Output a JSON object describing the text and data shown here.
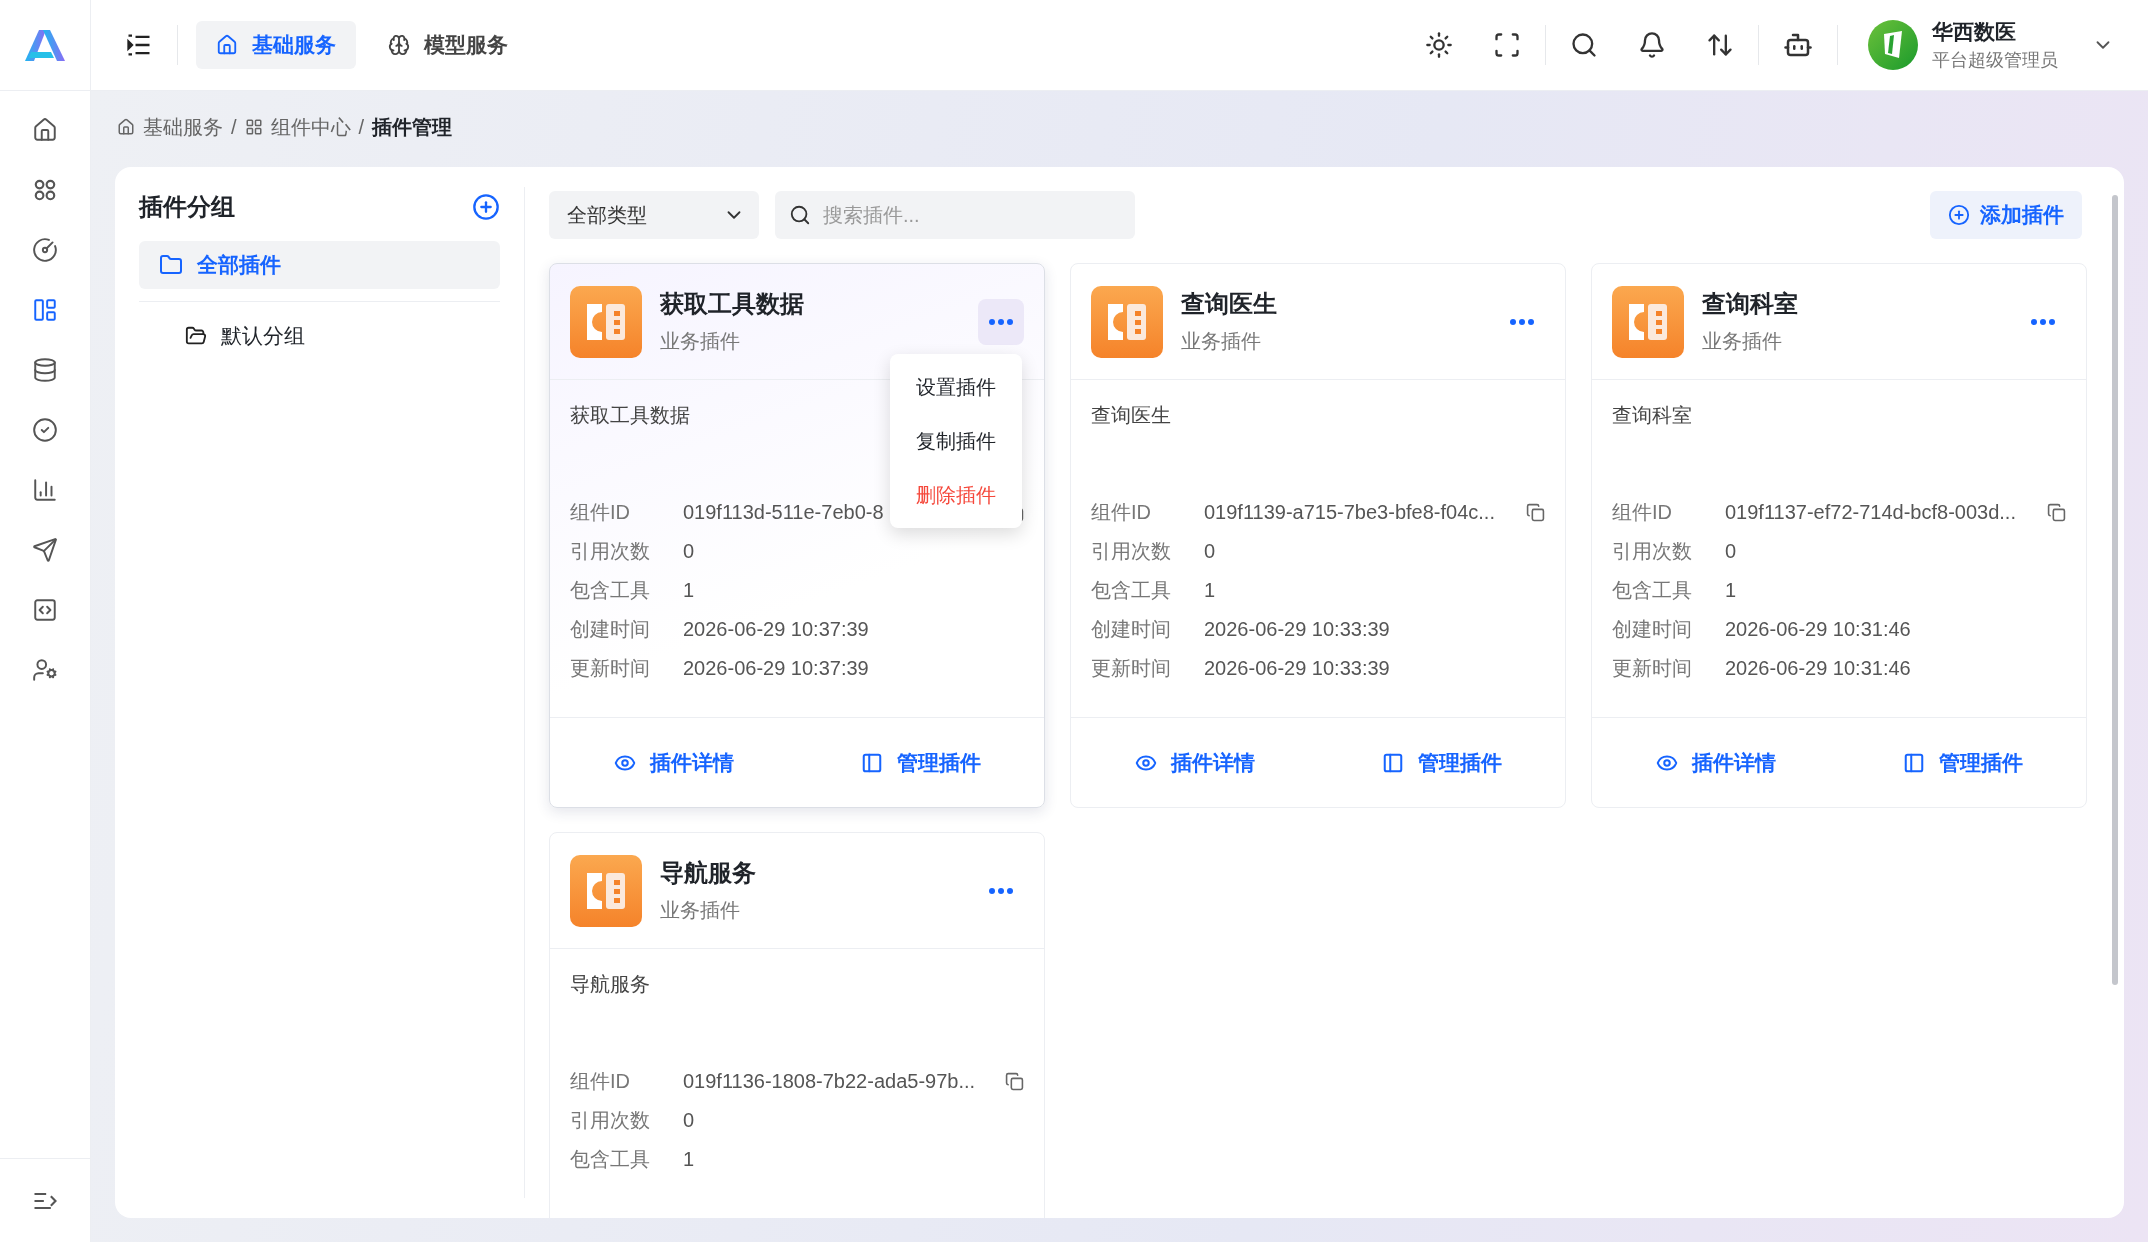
{
  "header": {
    "nav_tabs": [
      {
        "label": "基础服务",
        "kind": "home",
        "selected": true
      },
      {
        "label": "模型服务",
        "kind": "brain",
        "selected": false
      }
    ],
    "user": {
      "name": "华西数医",
      "role": "平台超级管理员"
    }
  },
  "sidebar": {
    "items": [
      {
        "kind": "home",
        "selected": false
      },
      {
        "kind": "apps",
        "selected": false
      },
      {
        "kind": "gauge",
        "selected": false
      },
      {
        "kind": "layout",
        "selected": true
      },
      {
        "kind": "database",
        "selected": false
      },
      {
        "kind": "check",
        "selected": false
      },
      {
        "kind": "chart",
        "selected": false
      },
      {
        "kind": "send",
        "selected": false
      },
      {
        "kind": "code",
        "selected": false
      },
      {
        "kind": "user-settings",
        "selected": false
      }
    ]
  },
  "breadcrumb": {
    "separator": "/",
    "items": [
      {
        "label": "基础服务",
        "kind": "home"
      },
      {
        "label": "组件中心",
        "kind": "grid"
      },
      {
        "label": "插件管理",
        "kind": "current"
      }
    ]
  },
  "groups": {
    "title": "插件分组",
    "items": [
      {
        "label": "全部插件",
        "selected": true,
        "children": [
          {
            "label": "默认分组",
            "selected": false
          }
        ]
      }
    ]
  },
  "toolbar": {
    "type_select": "全部类型",
    "search": {
      "placeholder": "搜索插件..."
    },
    "add_button": "添加插件"
  },
  "plugins": [
    {
      "name": "获取工具数据",
      "type": "业务插件",
      "description": "获取工具数据",
      "highlighted": true,
      "id_field": {
        "label": "组件ID",
        "value": "019f113d-511e-7eb0-8"
      },
      "fields": [
        {
          "label": "引用次数",
          "value": "0"
        },
        {
          "label": "包含工具",
          "value": "1"
        },
        {
          "label": "创建时间",
          "value": "2026-06-29 10:37:39"
        },
        {
          "label": "更新时间",
          "value": "2026-06-29 10:37:39"
        }
      ],
      "actions": [
        {
          "label": "插件详情",
          "kind": "view"
        },
        {
          "label": "管理插件",
          "kind": "manage"
        }
      ],
      "menu": [
        {
          "label": "设置插件",
          "kind": "normal"
        },
        {
          "label": "复制插件",
          "kind": "normal"
        },
        {
          "label": "删除插件",
          "kind": "danger"
        }
      ]
    },
    {
      "name": "查询医生",
      "type": "业务插件",
      "description": "查询医生",
      "highlighted": false,
      "id_field": {
        "label": "组件ID",
        "value": "019f1139-a715-7be3-bfe8-f04c..."
      },
      "fields": [
        {
          "label": "引用次数",
          "value": "0"
        },
        {
          "label": "包含工具",
          "value": "1"
        },
        {
          "label": "创建时间",
          "value": "2026-06-29 10:33:39"
        },
        {
          "label": "更新时间",
          "value": "2026-06-29 10:33:39"
        }
      ],
      "actions": [
        {
          "label": "插件详情",
          "kind": "view"
        },
        {
          "label": "管理插件",
          "kind": "manage"
        }
      ]
    },
    {
      "name": "查询科室",
      "type": "业务插件",
      "description": "查询科室",
      "highlighted": false,
      "id_field": {
        "label": "组件ID",
        "value": "019f1137-ef72-714d-bcf8-003d..."
      },
      "fields": [
        {
          "label": "引用次数",
          "value": "0"
        },
        {
          "label": "包含工具",
          "value": "1"
        },
        {
          "label": "创建时间",
          "value": "2026-06-29 10:31:46"
        },
        {
          "label": "更新时间",
          "value": "2026-06-29 10:31:46"
        }
      ],
      "actions": [
        {
          "label": "插件详情",
          "kind": "view"
        },
        {
          "label": "管理插件",
          "kind": "manage"
        }
      ]
    },
    {
      "name": "导航服务",
      "type": "业务插件",
      "description": "导航服务",
      "highlighted": false,
      "id_field": {
        "label": "组件ID",
        "value": "019f1136-1808-7b22-ada5-97b..."
      },
      "fields": [
        {
          "label": "引用次数",
          "value": "0"
        },
        {
          "label": "包含工具",
          "value": "1"
        }
      ]
    }
  ]
}
